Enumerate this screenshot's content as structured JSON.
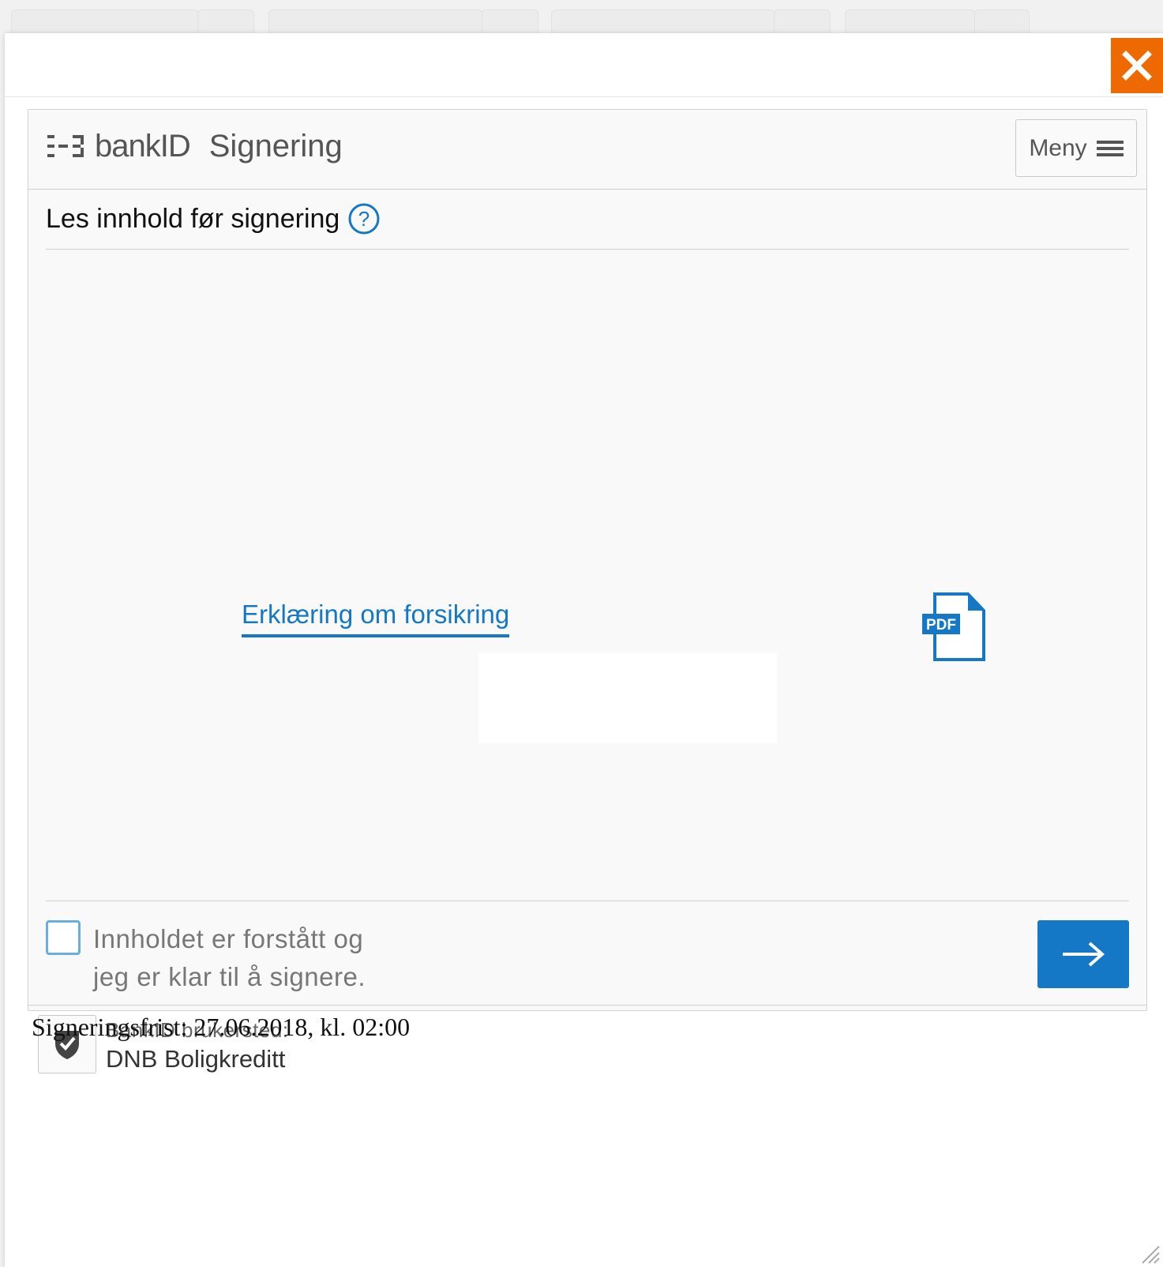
{
  "modal": {
    "close_label": "✕"
  },
  "bankid": {
    "logo_text": "bankID",
    "title": "Signering",
    "menu_label": "Meny",
    "section_title": "Les innhold før signering",
    "help_glyph": "?",
    "document": {
      "link_label": "Erklæring om forsikring",
      "file_type": "PDF"
    },
    "confirm": {
      "line1": "Innholdet er forstått og",
      "line2": "jeg er klar til å signere.",
      "checked": false
    },
    "merchant": {
      "label": "BankID brukersted:",
      "name": "DNB Boligkreditt"
    }
  },
  "deadline_text": "Signeringsfrist: 27.06.2018, kl. 02:00",
  "colors": {
    "accent": "#1478c6",
    "close": "#ee6a00"
  },
  "icons": [
    "close-icon",
    "bankid-logo-icon",
    "hamburger-icon",
    "help-icon",
    "pdf-icon",
    "arrow-right-icon",
    "shield-check-icon",
    "resize-grip-icon"
  ]
}
